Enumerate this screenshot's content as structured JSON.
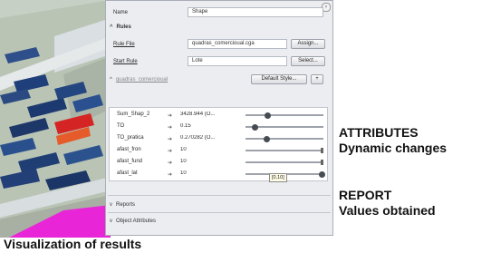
{
  "colors": {
    "accent": "#e826d8",
    "panel_bg": "#ecedf1",
    "field_bg": "#ffffff"
  },
  "inspector": {
    "name_label": "Name",
    "name_value": "Shape",
    "rules_header": "Rules",
    "rule_file_label": "Rule File",
    "rule_file_value": "quadras_comercioual.cga",
    "assign_button": "Assign...",
    "start_rule_label": "Start Rule",
    "start_rule_value": "Lote",
    "select_button": "Select...",
    "rule_name": "quadras_comercioual",
    "default_style_button": "Default Style...",
    "add_button": "+",
    "attributes": [
      {
        "name": "Sum_Shap_2",
        "value": "3428.944 (O...",
        "level": 0.28
      },
      {
        "name": "TO",
        "value": "0.15",
        "level": 0.12
      },
      {
        "name": "TO_pratica",
        "value": "0.270282 (O...",
        "level": 0.27
      },
      {
        "name": "afast_fron",
        "value": "10",
        "level": 1.0
      },
      {
        "name": "afast_fund",
        "value": "10",
        "level": 1.0
      },
      {
        "name": "afast_lat",
        "value": "10",
        "level": 1.0
      }
    ],
    "tooltip": "[0,10]",
    "reports_header": "Reports",
    "object_attributes_header": "Object Attributes"
  },
  "annotations": {
    "attributes_title": "ATTRIBUTES",
    "attributes_subtitle": "Dynamic changes",
    "report_title": "REPORT",
    "report_subtitle": "Values obtained",
    "caption": "Visualization of results"
  }
}
